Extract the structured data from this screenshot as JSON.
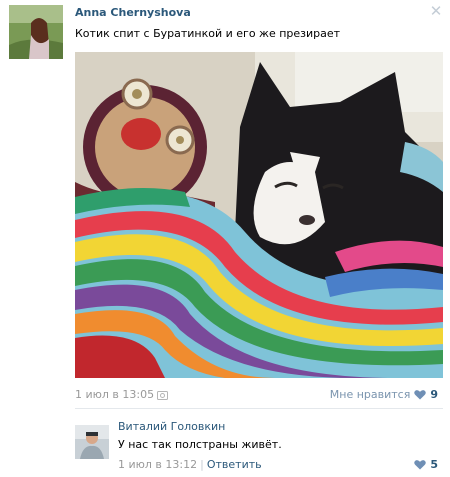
{
  "post": {
    "author_name": "Anna Chernyshova",
    "text": "Котик спит с Буратинкой и его же презирает",
    "close_glyph": "✕",
    "date": "1 июл в 13:05",
    "like_label": "Мне нравится",
    "like_count": "9"
  },
  "comment": {
    "author_name": "Виталий Головкин",
    "text": "У нас так полстраны живёт.",
    "date": "1 июл в 13:12",
    "separator": "|",
    "reply_label": "Ответить",
    "like_count": "5"
  },
  "colors": {
    "link": "#2b587a",
    "muted": "#999999",
    "heart": "#6f8fb5"
  },
  "icons": {
    "close": "close-icon",
    "camera": "camera-icon",
    "like": "heart-icon"
  }
}
